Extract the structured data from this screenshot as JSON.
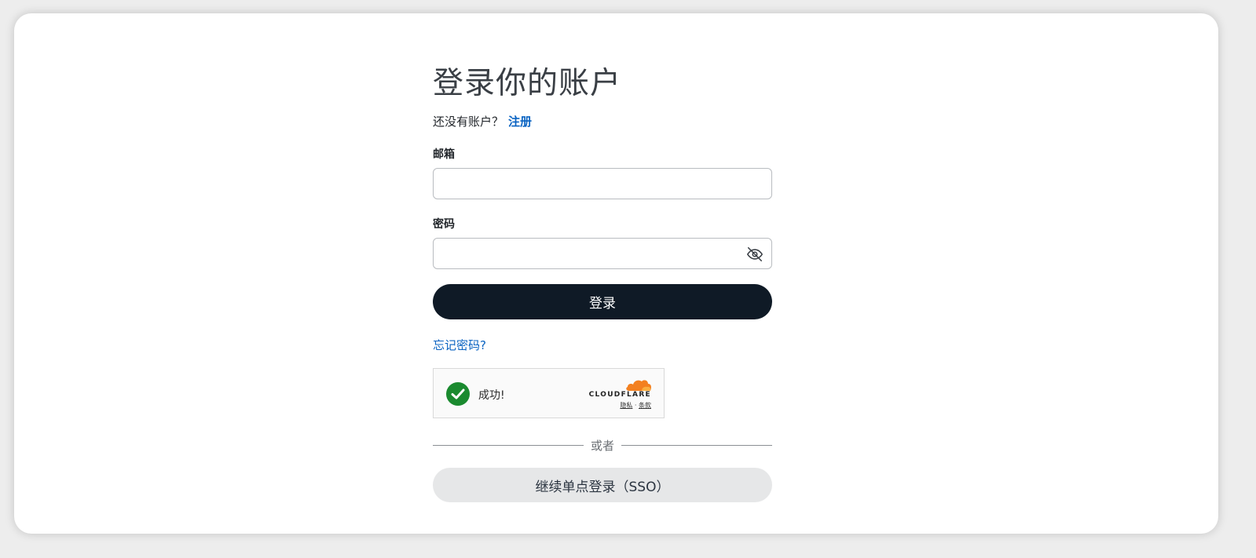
{
  "page": {
    "title": "登录你的账户",
    "no_account_text": "还没有账户？",
    "signup_link": "注册"
  },
  "form": {
    "email_label": "邮箱",
    "email_value": "",
    "password_label": "密码",
    "password_value": "",
    "password_toggle_icon": "eye-off-icon",
    "submit_label": "登录",
    "forgot_password": "忘记密码?"
  },
  "captcha": {
    "status": "成功!",
    "status_icon": "check-circle-icon",
    "provider": "CLOUDFLARE",
    "privacy_link": "隐私",
    "separator": "·",
    "terms_link": "条款"
  },
  "divider_text": "或者",
  "sso_label": "继续单点登录（SSO）",
  "colors": {
    "link": "#0a63c2",
    "primary_button": "#0f1a26",
    "secondary_button": "#e6e7e8",
    "success": "#1a8a2f",
    "cloudflare_orange": "#f38020"
  }
}
